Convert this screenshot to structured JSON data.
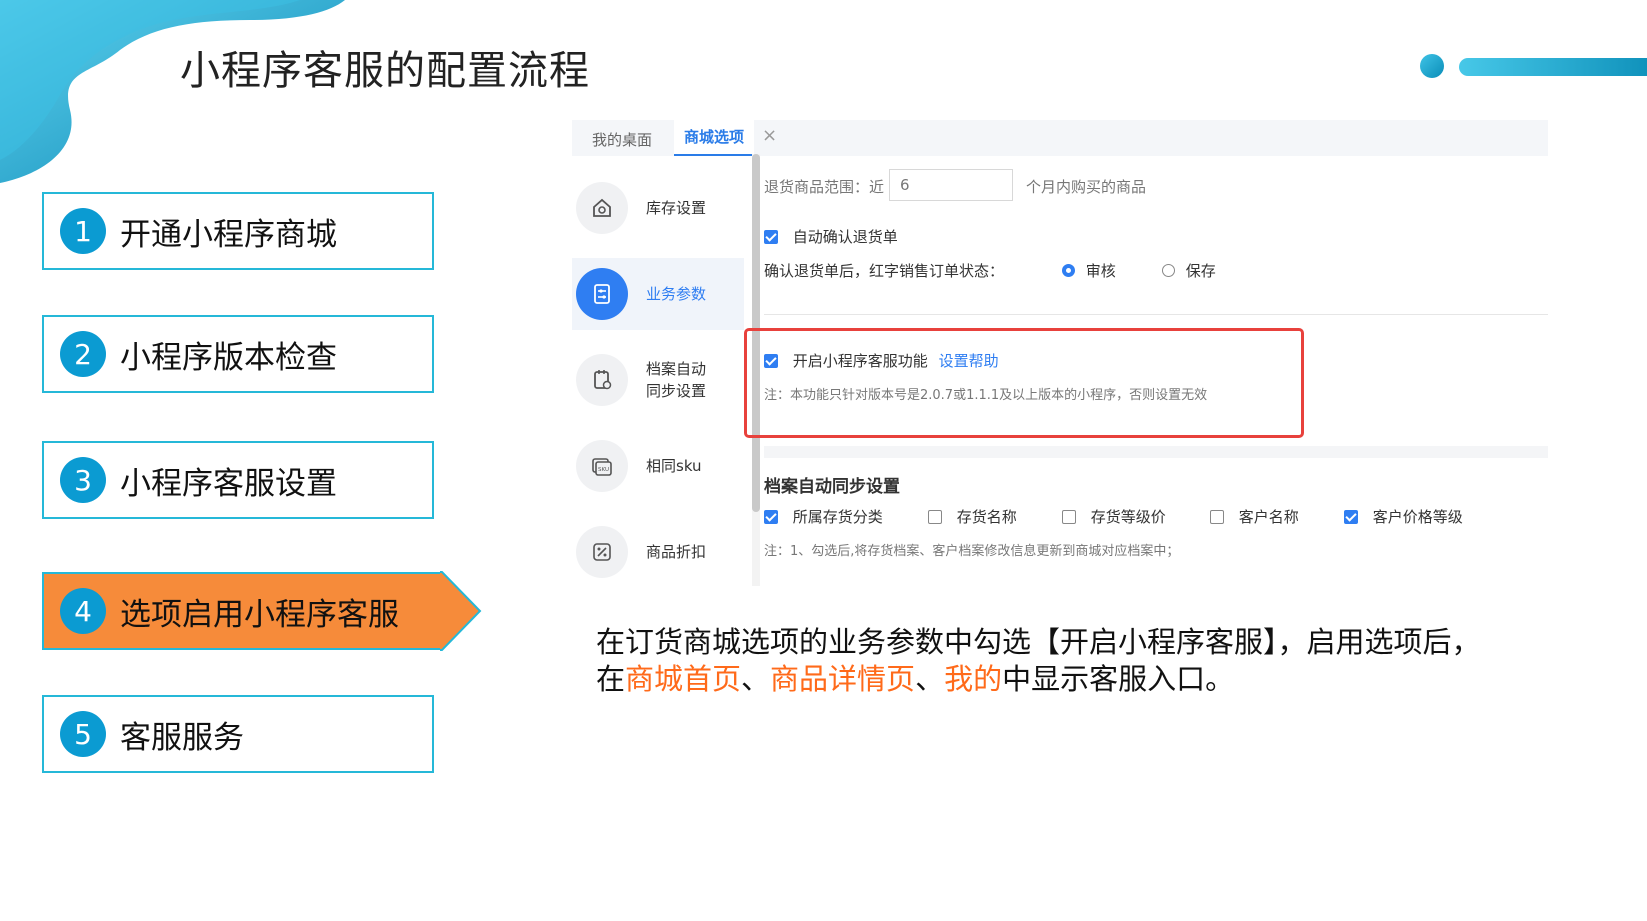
{
  "slide": {
    "title": "小程序客服的配置流程",
    "colors": {
      "accent": "#0b9bd2",
      "active_step": "#f68b3a",
      "step_border": "#25b8d8",
      "highlight_text": "#ff6a1a"
    }
  },
  "steps": [
    {
      "num": "1",
      "label": "开通小程序商城",
      "active": false
    },
    {
      "num": "2",
      "label": "小程序版本检查",
      "active": false
    },
    {
      "num": "3",
      "label": "小程序客服设置",
      "active": false
    },
    {
      "num": "4",
      "label": "选项启用小程序客服",
      "active": true
    },
    {
      "num": "5",
      "label": "客服服务",
      "active": false
    }
  ],
  "screenshot": {
    "tabs": {
      "desk": "我的桌面",
      "mall": "商城选项",
      "close": "×"
    },
    "nav": [
      {
        "label": "库存设置",
        "icon": "house-gear-icon",
        "selected": false
      },
      {
        "label": "业务参数",
        "icon": "sliders-doc-icon",
        "selected": true
      },
      {
        "label": "档案自动\n同步设置",
        "icon": "sync-doc-icon",
        "selected": false
      },
      {
        "label": "相同sku",
        "icon": "sku-icon",
        "selected": false
      },
      {
        "label": "商品折扣",
        "icon": "discount-icon",
        "selected": false
      }
    ],
    "return_range": {
      "prefix": "退货商品范围：近",
      "value": "6",
      "suffix": "个月内购买的商品"
    },
    "auto_confirm": {
      "label": "自动确认退货单",
      "checked": true
    },
    "status_row": {
      "label": "确认退货单后，红字销售订单状态：",
      "options": [
        "审核",
        "保存"
      ],
      "selected": "审核"
    },
    "miniapp_service": {
      "label": "开启小程序客服功能",
      "help_link": "设置帮助",
      "checked": true,
      "note": "注：本功能只针对版本号是2.0.7或1.1.1及以上版本的小程序，否则设置无效"
    },
    "sync_section": {
      "title": "档案自动同步设置",
      "options": [
        {
          "label": "所属存货分类",
          "checked": true
        },
        {
          "label": "存货名称",
          "checked": false
        },
        {
          "label": "存货等级价",
          "checked": false
        },
        {
          "label": "客户名称",
          "checked": false
        },
        {
          "label": "客户价格等级",
          "checked": true
        }
      ],
      "note": "注：1、勾选后,将存货档案、客户档案修改信息更新到商城对应档案中；"
    }
  },
  "description": {
    "line1": "在订货商城选项的业务参数中勾选【开启小程序客服】，启用选项后，",
    "line2_pre": "在",
    "hl1": "商城首页",
    "sep1": "、",
    "hl2": "商品详情页",
    "sep2": "、",
    "hl3": "我的",
    "line2_post": "中显示客服入口。"
  }
}
